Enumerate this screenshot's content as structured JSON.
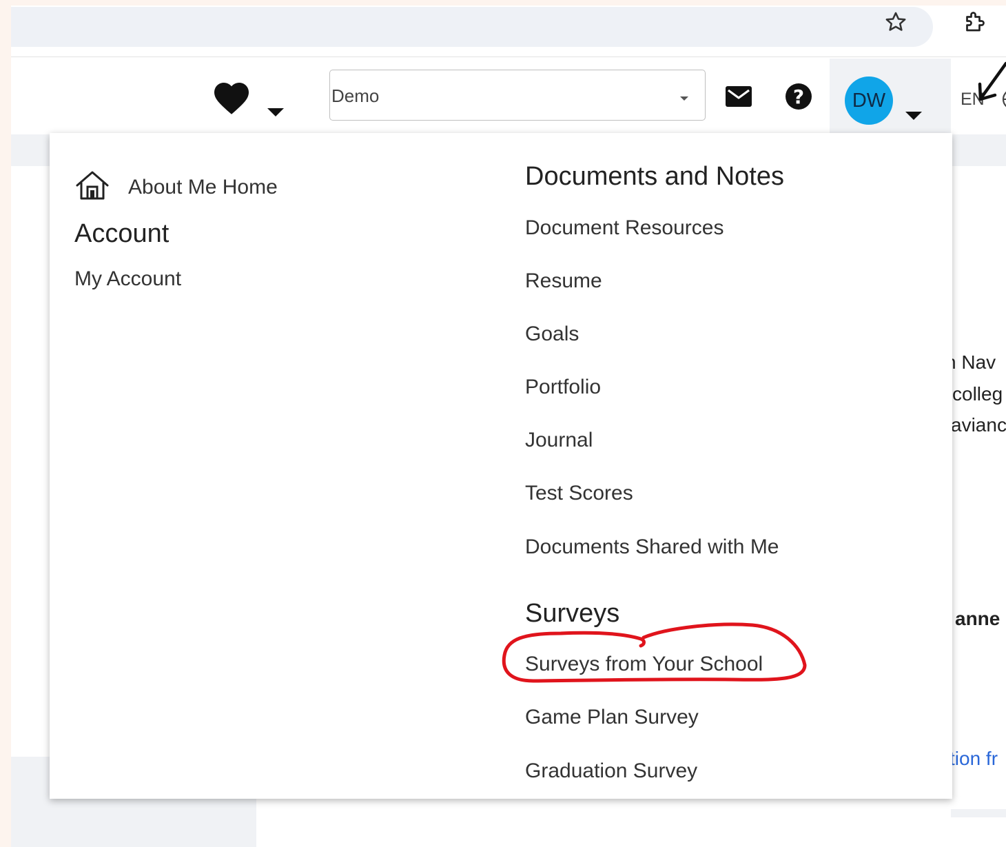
{
  "header": {
    "role_select": {
      "value": "Demo"
    },
    "user_initials": "DW",
    "language": "EN"
  },
  "menu": {
    "home_label": "About Me Home",
    "account": {
      "heading": "Account",
      "items": [
        "My Account"
      ]
    },
    "documents": {
      "heading": "Documents and Notes",
      "items": [
        "Document Resources",
        "Resume",
        "Goals",
        "Portfolio",
        "Journal",
        "Test Scores",
        "Documents Shared with Me"
      ]
    },
    "surveys": {
      "heading": "Surveys",
      "items": [
        "Surveys from Your School",
        "Game Plan Survey",
        "Graduation Survey"
      ]
    }
  },
  "background_fragments": {
    "line1": "n Nav",
    "line2": "colleg",
    "line3": "avianc",
    "bold": "anne",
    "link": "tion fr"
  },
  "colors": {
    "avatar": "#10a5e8",
    "annotation": "#e0141c",
    "link": "#2a67d8"
  },
  "icons": [
    "star-icon",
    "extension-icon",
    "heart-icon",
    "mail-icon",
    "help-icon",
    "globe-icon",
    "home-icon"
  ]
}
